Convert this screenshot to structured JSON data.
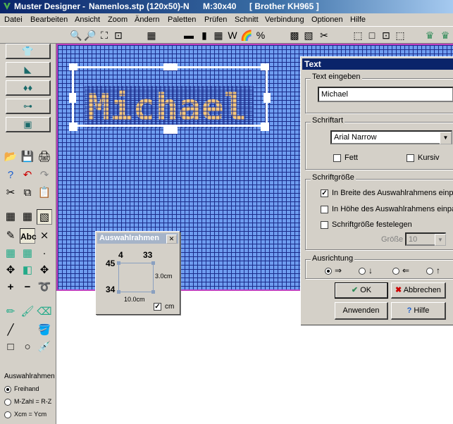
{
  "window": {
    "app_name": "Muster Designer",
    "sep": "-",
    "document": "Namenlos.stp (120x50)-N",
    "m_size": "M:30x40",
    "machine": "[ Brother KH965 ]"
  },
  "menu": [
    "Datei",
    "Bearbeiten",
    "Ansicht",
    "Zoom",
    "Ändern",
    "Paletten",
    "Prüfen",
    "Schnitt",
    "Verbindung",
    "Optionen",
    "Hilfe"
  ],
  "left_tools": {
    "abc_label": "Abc",
    "plus": "+",
    "minus": "−"
  },
  "selection_box": {
    "title": "Auswahlrahmen",
    "options": [
      "Freihand",
      "M-Zahl = R-Z",
      "Xcm = Ycm"
    ],
    "selected": 0
  },
  "canvas_text": "Michael",
  "text_dialog": {
    "title": "Text",
    "input_group": "Text eingeben",
    "text_value": "Michael",
    "font_group": "Schriftart",
    "font_value": "Arial Narrow",
    "bold_label": "Fett",
    "italic_label": "Kursiv",
    "bold_checked": false,
    "italic_checked": false,
    "size_group": "Schriftgröße",
    "fit_width_label": "In Breite des Auswahlrahmens einpa",
    "fit_height_label": "In Höhe des Auswahlrahmens einpas",
    "fixed_size_label": "Schriftgröße festelegen",
    "fit_width_checked": true,
    "fit_height_checked": false,
    "fixed_size_checked": false,
    "size_label": "Größe",
    "size_value": "10",
    "align_group": "Ausrichtung",
    "ok_label": "OK",
    "cancel_label": "Abbrechen",
    "apply_label": "Anwenden",
    "help_label": "Hilfe"
  },
  "frame_dialog": {
    "title": "Auswahlrahmen",
    "close": "✕",
    "left_col": "4",
    "right_col": "33",
    "top_row": "45",
    "bottom_row": "34",
    "height_label": "3.0cm",
    "width_label": "10.0cm",
    "unit_label": "cm",
    "cm_checked": true
  },
  "colors": {
    "grid": "#6f9df0",
    "gridline": "#1a2b8a",
    "text_cells": "#f4c679",
    "titlebar": "#0a246a"
  }
}
